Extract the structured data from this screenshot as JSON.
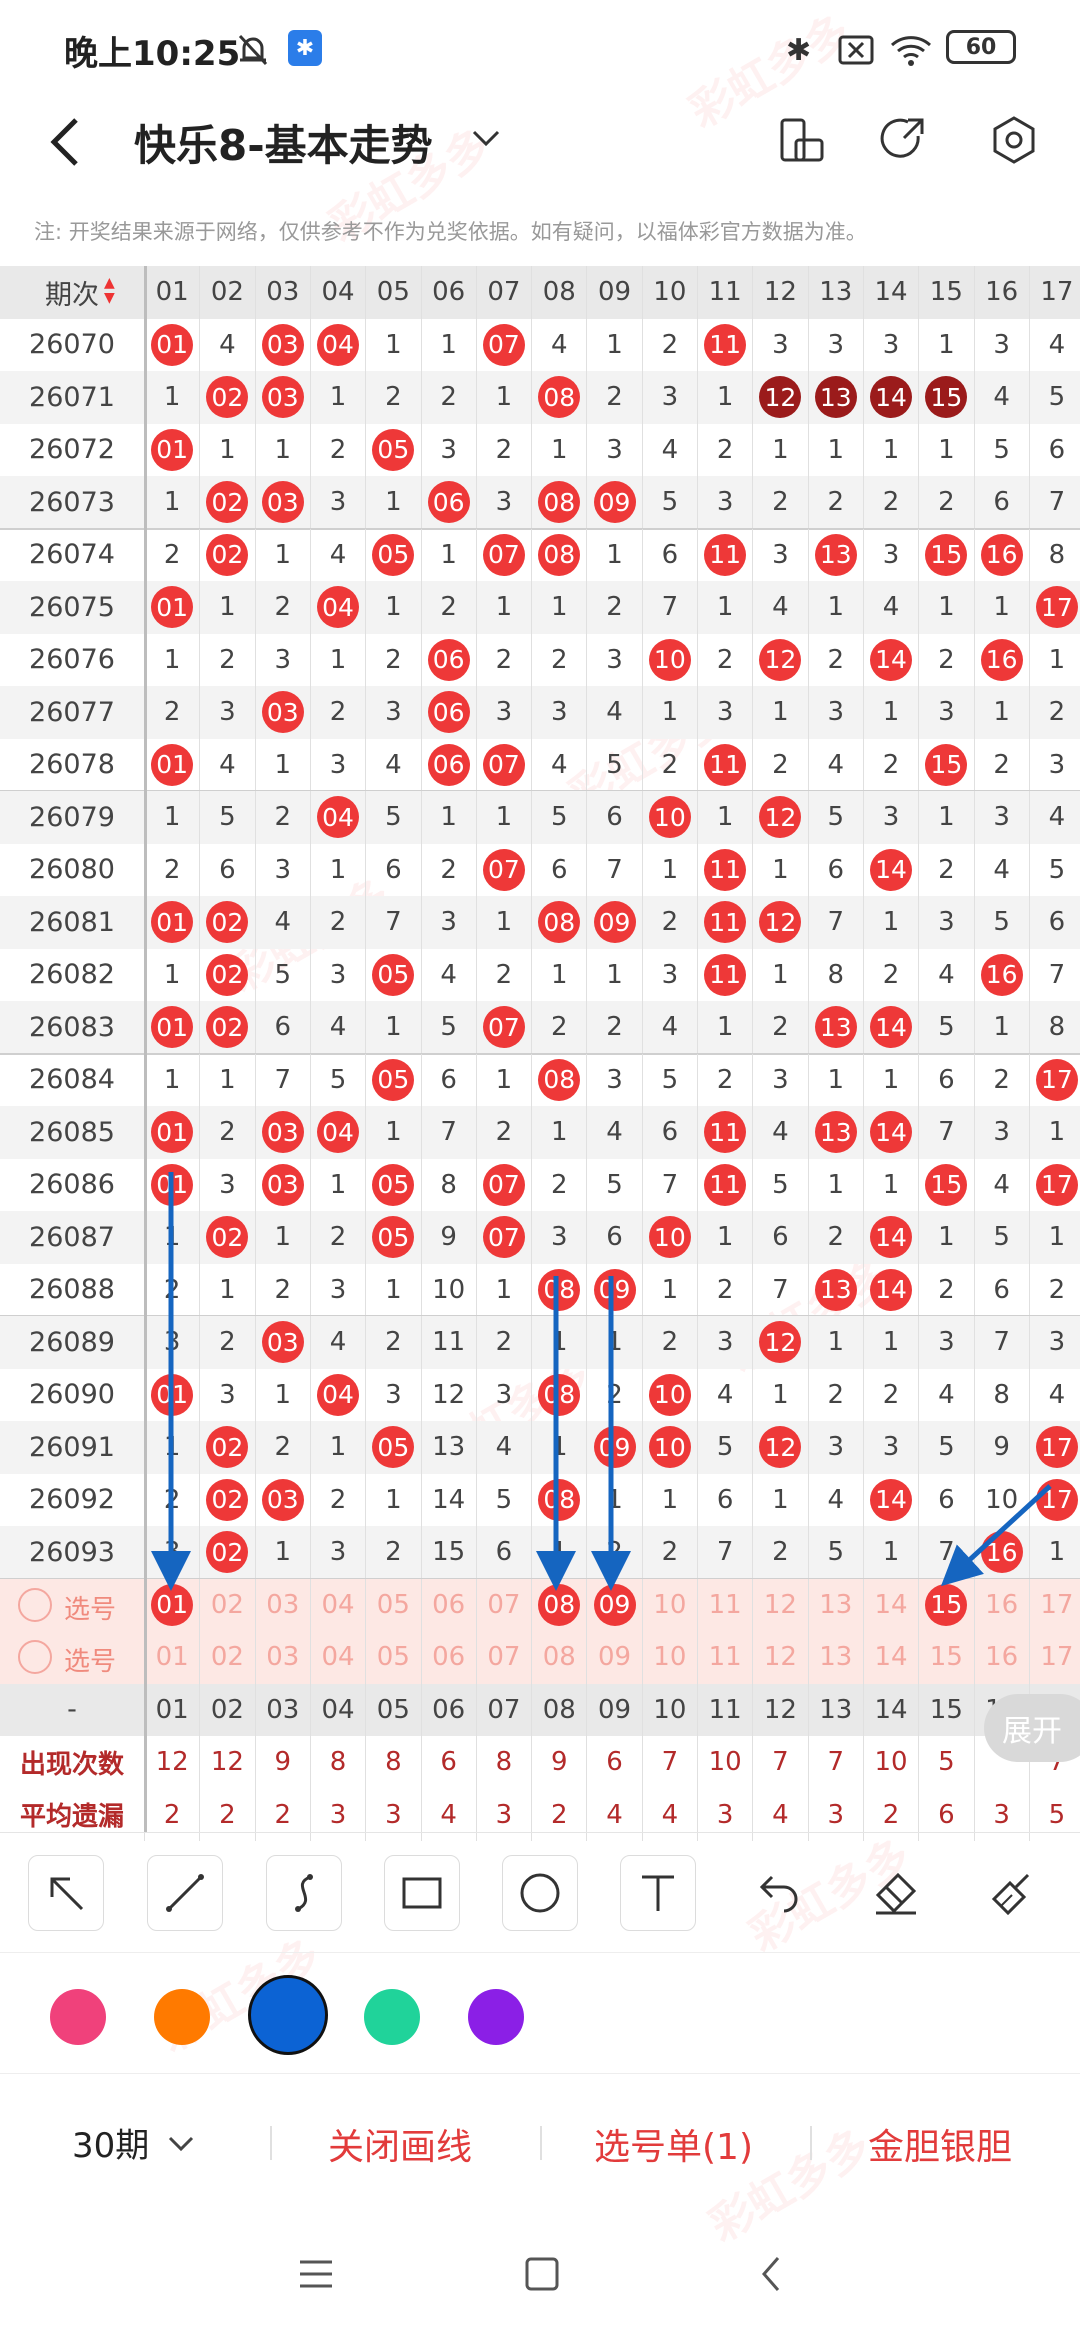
{
  "status_bar": {
    "time": "晚上10:25",
    "battery": "60"
  },
  "nav": {
    "title": "快乐8-基本走势"
  },
  "notice": "注: 开奖结果来源于网络，仅供参考不作为兑奖依据。如有疑问，以福体彩官方数据为准。",
  "table": {
    "issue_header": "期次",
    "columns": [
      "01",
      "02",
      "03",
      "04",
      "05",
      "06",
      "07",
      "08",
      "09",
      "10",
      "11",
      "12",
      "13",
      "14",
      "15",
      "16",
      "17"
    ],
    "rows": [
      {
        "issue": "26070",
        "cells": [
          "01",
          "4",
          "03",
          "04",
          "1",
          "1",
          "07",
          "4",
          "1",
          "2",
          "11",
          "3",
          "3",
          "3",
          "1",
          "3",
          "4"
        ]
      },
      {
        "issue": "26071",
        "cells": [
          "1",
          "02",
          "03",
          "1",
          "2",
          "2",
          "1",
          "08",
          "2",
          "3",
          "1",
          "12",
          "13",
          "14",
          "15",
          "4",
          "5"
        ]
      },
      {
        "issue": "26072",
        "cells": [
          "01",
          "1",
          "1",
          "2",
          "05",
          "3",
          "2",
          "1",
          "3",
          "4",
          "2",
          "1",
          "1",
          "1",
          "1",
          "5",
          "6"
        ]
      },
      {
        "issue": "26073",
        "cells": [
          "1",
          "02",
          "03",
          "3",
          "1",
          "06",
          "3",
          "08",
          "09",
          "5",
          "3",
          "2",
          "2",
          "2",
          "2",
          "6",
          "7"
        ]
      },
      {
        "issue": "26074",
        "cells": [
          "2",
          "02",
          "1",
          "4",
          "05",
          "1",
          "07",
          "08",
          "1",
          "6",
          "11",
          "3",
          "13",
          "3",
          "15",
          "16",
          "8"
        ]
      },
      {
        "issue": "26075",
        "cells": [
          "01",
          "1",
          "2",
          "04",
          "1",
          "2",
          "1",
          "1",
          "2",
          "7",
          "1",
          "4",
          "1",
          "4",
          "1",
          "1",
          "17"
        ]
      },
      {
        "issue": "26076",
        "cells": [
          "1",
          "2",
          "3",
          "1",
          "2",
          "06",
          "2",
          "2",
          "3",
          "10",
          "2",
          "12",
          "2",
          "14",
          "2",
          "16",
          "1"
        ]
      },
      {
        "issue": "26077",
        "cells": [
          "2",
          "3",
          "03",
          "2",
          "3",
          "06",
          "3",
          "3",
          "4",
          "1",
          "3",
          "1",
          "3",
          "1",
          "3",
          "1",
          "2"
        ]
      },
      {
        "issue": "26078",
        "cells": [
          "01",
          "4",
          "1",
          "3",
          "4",
          "06",
          "07",
          "4",
          "5",
          "2",
          "11",
          "2",
          "4",
          "2",
          "15",
          "2",
          "3"
        ]
      },
      {
        "issue": "26079",
        "cells": [
          "1",
          "5",
          "2",
          "04",
          "5",
          "1",
          "1",
          "5",
          "6",
          "10",
          "1",
          "12",
          "5",
          "3",
          "1",
          "3",
          "4"
        ]
      },
      {
        "issue": "26080",
        "cells": [
          "2",
          "6",
          "3",
          "1",
          "6",
          "2",
          "07",
          "6",
          "7",
          "1",
          "11",
          "1",
          "6",
          "14",
          "2",
          "4",
          "5"
        ]
      },
      {
        "issue": "26081",
        "cells": [
          "01",
          "02",
          "4",
          "2",
          "7",
          "3",
          "1",
          "08",
          "09",
          "2",
          "11",
          "12",
          "7",
          "1",
          "3",
          "5",
          "6"
        ]
      },
      {
        "issue": "26082",
        "cells": [
          "1",
          "02",
          "5",
          "3",
          "05",
          "4",
          "2",
          "1",
          "1",
          "3",
          "11",
          "1",
          "8",
          "2",
          "4",
          "16",
          "7"
        ]
      },
      {
        "issue": "26083",
        "cells": [
          "01",
          "02",
          "6",
          "4",
          "1",
          "5",
          "07",
          "2",
          "2",
          "4",
          "1",
          "2",
          "13",
          "14",
          "5",
          "1",
          "8"
        ]
      },
      {
        "issue": "26084",
        "cells": [
          "1",
          "1",
          "7",
          "5",
          "05",
          "6",
          "1",
          "08",
          "3",
          "5",
          "2",
          "3",
          "1",
          "1",
          "6",
          "2",
          "17"
        ]
      },
      {
        "issue": "26085",
        "cells": [
          "01",
          "2",
          "03",
          "04",
          "1",
          "7",
          "2",
          "1",
          "4",
          "6",
          "11",
          "4",
          "13",
          "14",
          "7",
          "3",
          "1"
        ]
      },
      {
        "issue": "26086",
        "cells": [
          "01",
          "3",
          "03",
          "1",
          "05",
          "8",
          "07",
          "2",
          "5",
          "7",
          "11",
          "5",
          "1",
          "1",
          "15",
          "4",
          "17"
        ]
      },
      {
        "issue": "26087",
        "cells": [
          "1",
          "02",
          "1",
          "2",
          "05",
          "9",
          "07",
          "3",
          "6",
          "10",
          "1",
          "6",
          "2",
          "14",
          "1",
          "5",
          "1"
        ]
      },
      {
        "issue": "26088",
        "cells": [
          "2",
          "1",
          "2",
          "3",
          "1",
          "10",
          "1",
          "08",
          "09",
          "1",
          "2",
          "7",
          "13",
          "14",
          "2",
          "6",
          "2"
        ]
      },
      {
        "issue": "26089",
        "cells": [
          "3",
          "2",
          "03",
          "4",
          "2",
          "11",
          "2",
          "1",
          "1",
          "2",
          "3",
          "12",
          "1",
          "1",
          "3",
          "7",
          "3"
        ]
      },
      {
        "issue": "26090",
        "cells": [
          "01",
          "3",
          "1",
          "04",
          "3",
          "12",
          "3",
          "08",
          "2",
          "10",
          "4",
          "1",
          "2",
          "2",
          "4",
          "8",
          "4"
        ]
      },
      {
        "issue": "26091",
        "cells": [
          "1",
          "02",
          "2",
          "1",
          "05",
          "13",
          "4",
          "1",
          "09",
          "10",
          "5",
          "12",
          "3",
          "3",
          "5",
          "9",
          "17"
        ]
      },
      {
        "issue": "26092",
        "cells": [
          "2",
          "02",
          "03",
          "2",
          "1",
          "14",
          "5",
          "08",
          "1",
          "1",
          "6",
          "1",
          "4",
          "14",
          "6",
          "10",
          "17"
        ]
      },
      {
        "issue": "26093",
        "cells": [
          "3",
          "02",
          "1",
          "3",
          "2",
          "15",
          "6",
          "1",
          "2",
          "2",
          "7",
          "2",
          "5",
          "1",
          "7",
          "16",
          "1"
        ]
      }
    ],
    "pick_rows": [
      {
        "label": "选号",
        "selected": [
          "01",
          "08",
          "09",
          "15"
        ]
      },
      {
        "label": "选号",
        "selected": []
      }
    ],
    "footer_header": "-",
    "stats": [
      {
        "label": "出现次数",
        "values": [
          "12",
          "12",
          "9",
          "8",
          "8",
          "6",
          "8",
          "9",
          "6",
          "7",
          "10",
          "7",
          "7",
          "10",
          "5",
          "",
          "7"
        ]
      },
      {
        "label": "平均遗漏",
        "values": [
          "2",
          "2",
          "2",
          "3",
          "3",
          "4",
          "3",
          "2",
          "4",
          "4",
          "3",
          "4",
          "3",
          "2",
          "6",
          "3",
          "5"
        ]
      }
    ],
    "expand_label": "展开"
  },
  "tools": [
    "select-arrow",
    "line",
    "curve",
    "rectangle",
    "circle",
    "text",
    "undo",
    "eraser",
    "clear"
  ],
  "colors": [
    "#f0417b",
    "#ff7a00",
    "#0c63d4",
    "#20d39a",
    "#8b1fe6"
  ],
  "selected_color": "#0c63d4",
  "action_bar": {
    "period": "30期",
    "close_lines": "关闭画线",
    "pick_list": "选号单(1)",
    "gold_silver": "金胆银胆"
  },
  "watermark_text": "彩虹多多"
}
